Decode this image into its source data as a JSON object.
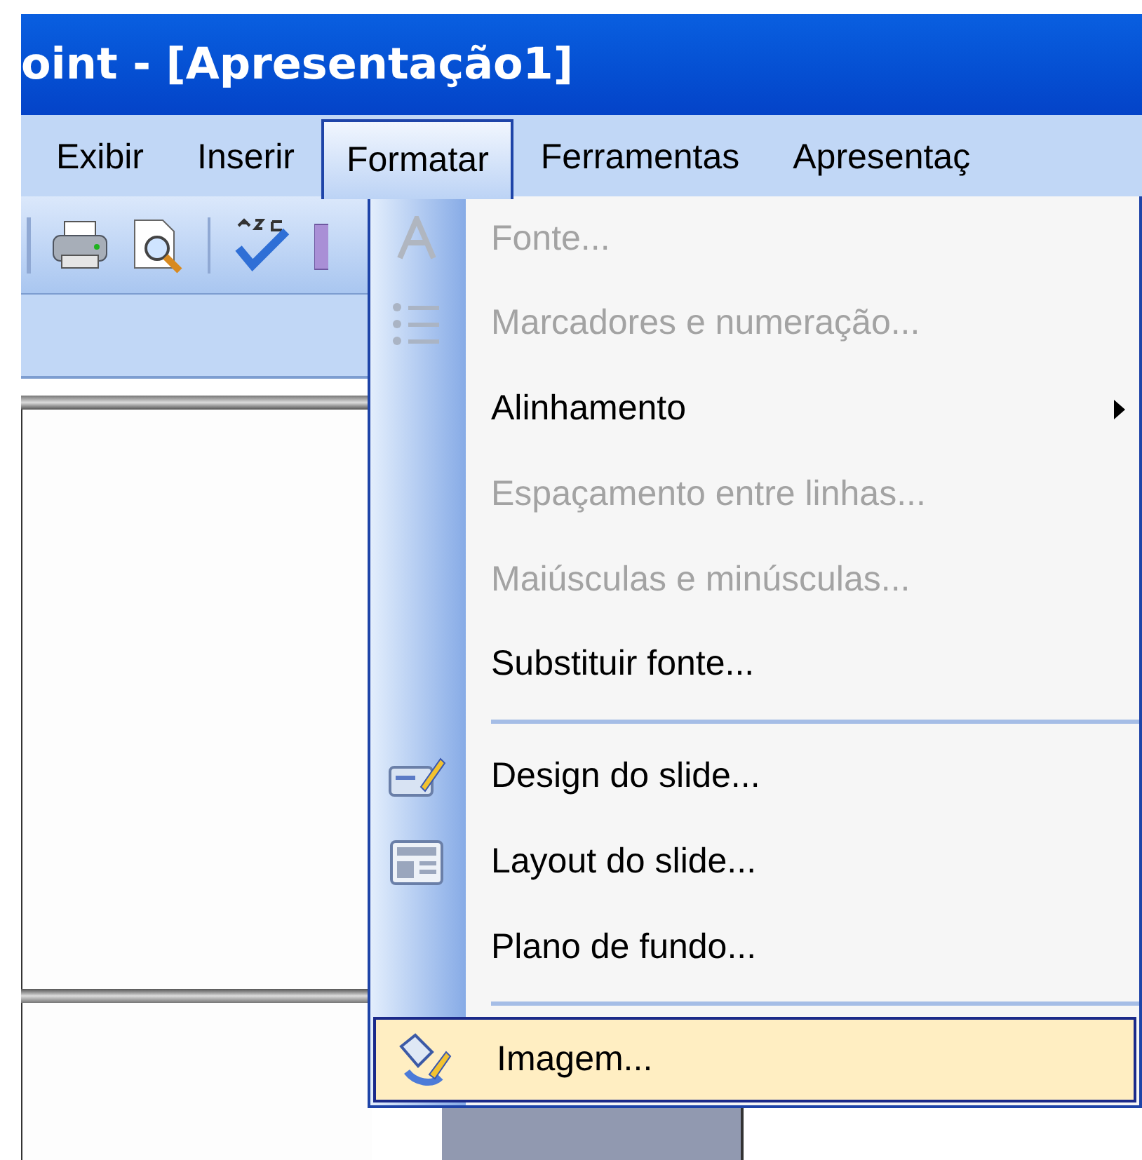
{
  "window": {
    "title": "oint - [Apresentação1]"
  },
  "menu_bar": [
    {
      "label": "Exibir",
      "selected": false
    },
    {
      "label": "Inserir",
      "selected": false
    },
    {
      "label": "Formatar",
      "selected": true
    },
    {
      "label": "Ferramentas",
      "selected": false
    },
    {
      "label": "Apresentaç",
      "selected": false
    }
  ],
  "menu": [
    {
      "kind": "item",
      "label": "Fonte...",
      "disabled": true,
      "submenu": false,
      "selected": false
    },
    {
      "kind": "item",
      "label": "Marcadores e numeração...",
      "disabled": true,
      "submenu": false,
      "selected": false
    },
    {
      "kind": "item",
      "label": "Alinhamento",
      "disabled": false,
      "submenu": true,
      "selected": false
    },
    {
      "kind": "item",
      "label": "Espaçamento entre linhas...",
      "disabled": true,
      "submenu": false,
      "selected": false
    },
    {
      "kind": "item",
      "label": "Maiúsculas e minúsculas...",
      "disabled": true,
      "submenu": false,
      "selected": false
    },
    {
      "kind": "item",
      "label": "Substituir fonte...",
      "disabled": false,
      "submenu": false,
      "selected": false
    },
    {
      "kind": "separator"
    },
    {
      "kind": "item",
      "label": "Design do slide...",
      "disabled": false,
      "submenu": false,
      "selected": false
    },
    {
      "kind": "item",
      "label": "Layout do slide...",
      "disabled": false,
      "submenu": false,
      "selected": false
    },
    {
      "kind": "item",
      "label": "Plano de fundo...",
      "disabled": false,
      "submenu": false,
      "selected": false
    },
    {
      "kind": "separator"
    },
    {
      "kind": "item",
      "label": "Imagem...",
      "disabled": false,
      "submenu": false,
      "selected": true
    }
  ]
}
